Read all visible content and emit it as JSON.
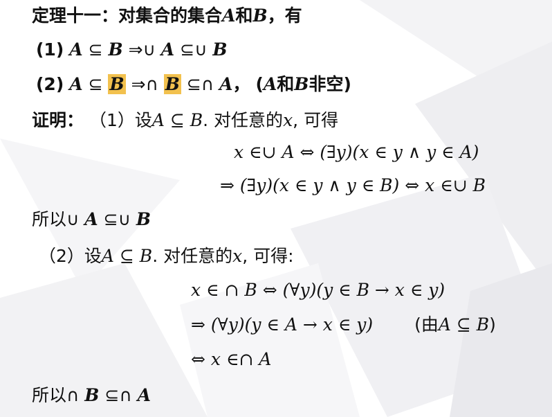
{
  "theorem": {
    "title": "定理十一：对集合的集合",
    "A": "A",
    "and": "和",
    "B": "B",
    "tail": "，有"
  },
  "statement1": {
    "label": "(1)",
    "A": "A",
    "sub": "⊆",
    "B": "B",
    "implies": "⇒∪",
    "A2": "A",
    "subu": "⊆∪",
    "B2": "B"
  },
  "statement2": {
    "label": "(2)",
    "A": "A",
    "sub": "⊆",
    "B": "B",
    "implies": "⇒∩",
    "B2": "B",
    "subn": "⊆∩",
    "A2": "A",
    "comma": "，",
    "note_open": "(",
    "note_A": "A",
    "note_and": "和",
    "note_B": "B",
    "note_tail": "非空)"
  },
  "proof": {
    "label": "证明：",
    "p1_intro": "（1）设",
    "p1_cond": "A ⊆ B",
    "p1_mid": ". 对任意的",
    "p1_x": "x",
    "p1_end": ", 可得",
    "eq1_lhs": "x ∈∪ A ⇔ (∃y)(x ∈ y ∧ y ∈ A)",
    "eq2": "⇒ (∃y)(x ∈ y ∧ y ∈ B) ⇔ x ∈∪ B",
    "conclusion1_prefix": "所以",
    "conclusion1_op": "∪",
    "conclusion1_A": "A",
    "conclusion1_sub": "⊆∪",
    "conclusion1_B": "B",
    "p2_intro": "（2）设",
    "p2_cond": "A ⊆ B",
    "p2_mid": ". 对任意的",
    "p2_x": "x",
    "p2_end": ", 可得:",
    "eq3": "x ∈ ∩ B ⇔ (∀y)(y ∈ B → x ∈ y)",
    "eq4": "⇒ (∀y)(y ∈ A → x ∈ y)",
    "eq4_note_open": "(由",
    "eq4_note_cond": "A ⊆ B",
    "eq4_note_close": ")",
    "eq5": "⇔ x ∈∩ A",
    "conclusion2_prefix": "所以",
    "conclusion2_op": "∩",
    "conclusion2_B": "B",
    "conclusion2_sub": "⊆∩",
    "conclusion2_A": "A"
  },
  "colors": {
    "highlight": "#f2c14e",
    "background": "#ffffff",
    "text": "#111111"
  }
}
